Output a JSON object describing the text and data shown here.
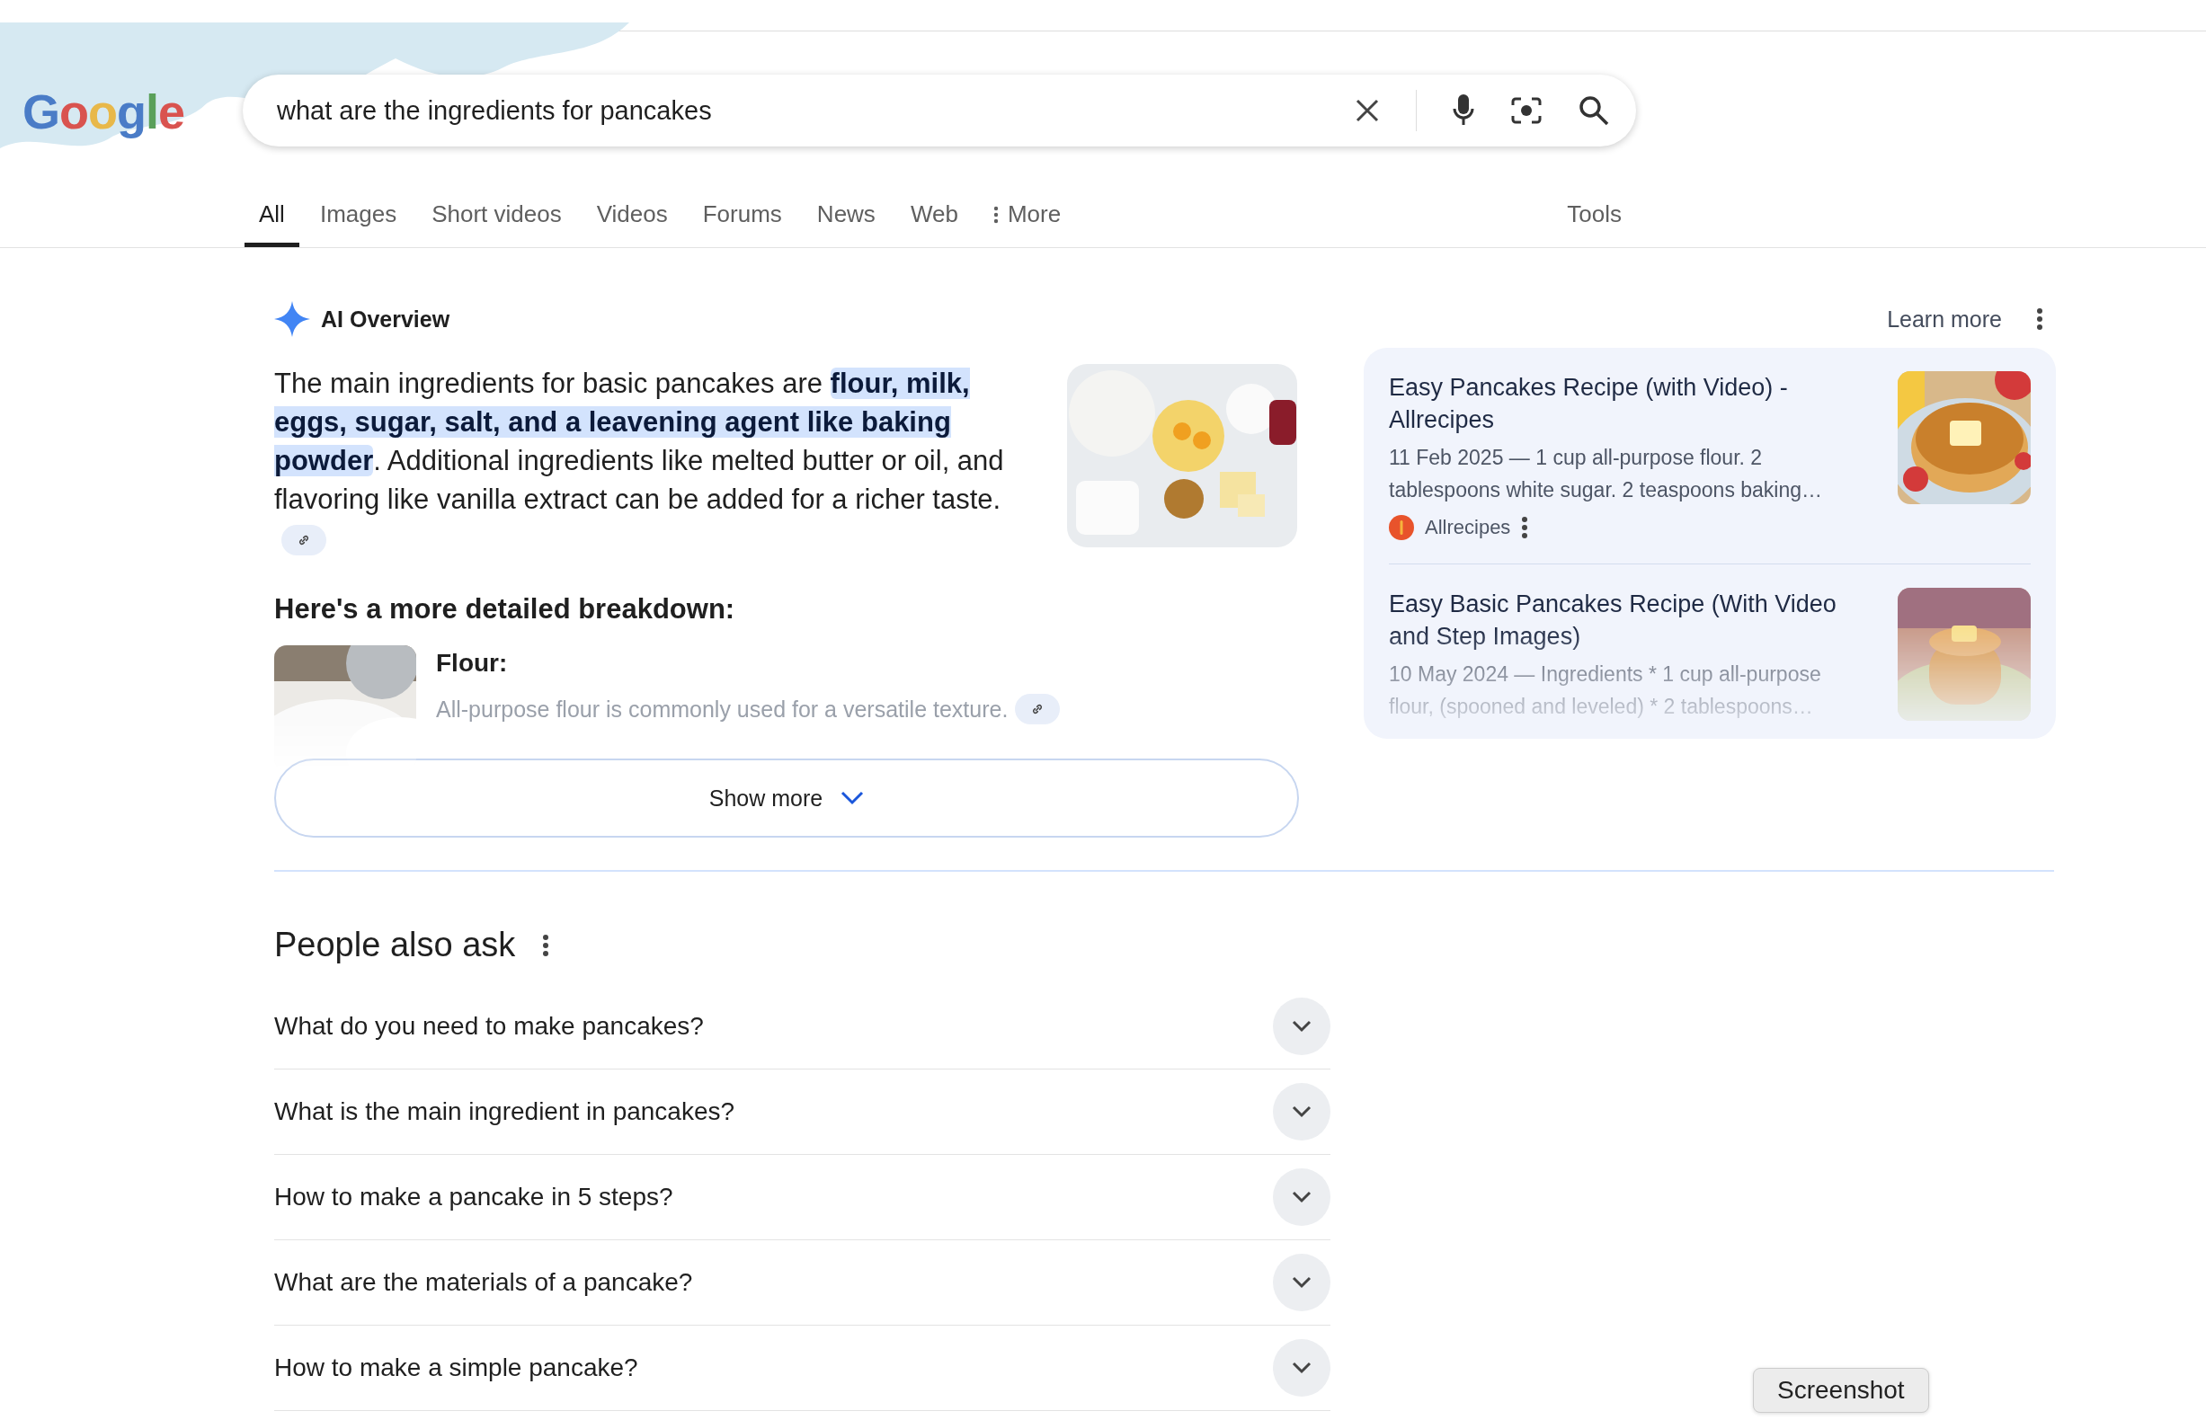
{
  "logo": "Google",
  "search": {
    "value": "what are the ingredients for pancakes"
  },
  "tabs": [
    {
      "label": "All",
      "selected": true
    },
    {
      "label": "Images",
      "selected": false
    },
    {
      "label": "Short videos",
      "selected": false
    },
    {
      "label": "Videos",
      "selected": false
    },
    {
      "label": "Forums",
      "selected": false
    },
    {
      "label": "News",
      "selected": false
    },
    {
      "label": "Web",
      "selected": false
    },
    {
      "label": "More",
      "selected": false,
      "kind": "menu"
    }
  ],
  "tools": "Tools",
  "ai_overview": {
    "title": "AI Overview",
    "learn_more": "Learn more",
    "summary": "The main ingredients for basic pancakes are **flour, milk, eggs, sugar, salt, and a leavening agent like baking powder**. Additional ingredients like melted butter or oil, and flavoring like vanilla extract can be added for a richer taste.",
    "breakdown_title": "Here's a more detailed breakdown:",
    "breakdown": [
      {
        "title": "Flour:",
        "text": "All-purpose flour is commonly used for a versatile texture."
      }
    ],
    "show_more": "Show more",
    "sources": [
      {
        "title": "Easy Pancakes Recipe (with Video) - Allrecipes",
        "snippet": "11 Feb 2025 — 1 cup all-purpose flour. 2 tablespoons white sugar. 2 teaspoons baking…",
        "site": "Allrecipes",
        "faded": false
      },
      {
        "title": "Easy Basic Pancakes Recipe (With Video and Step Images)",
        "snippet": "10 May 2024 — Ingredients * 1 cup all-purpose flour, (spooned and leveled) * 2 tablespoons…",
        "faded": true
      }
    ]
  },
  "people_also_ask": {
    "title": "People also ask",
    "questions": [
      {
        "text": "What do you need to make pancakes?",
        "expanded": false
      },
      {
        "text": "What is the main ingredient in pancakes?",
        "expanded": false
      },
      {
        "text": "How to make a pancake in 5 steps?",
        "expanded": false
      },
      {
        "text": "What are the materials of a pancake?",
        "expanded": false
      },
      {
        "text": "How to make a simple pancake?",
        "expanded": false
      }
    ]
  },
  "tooltip": "Screenshot"
}
